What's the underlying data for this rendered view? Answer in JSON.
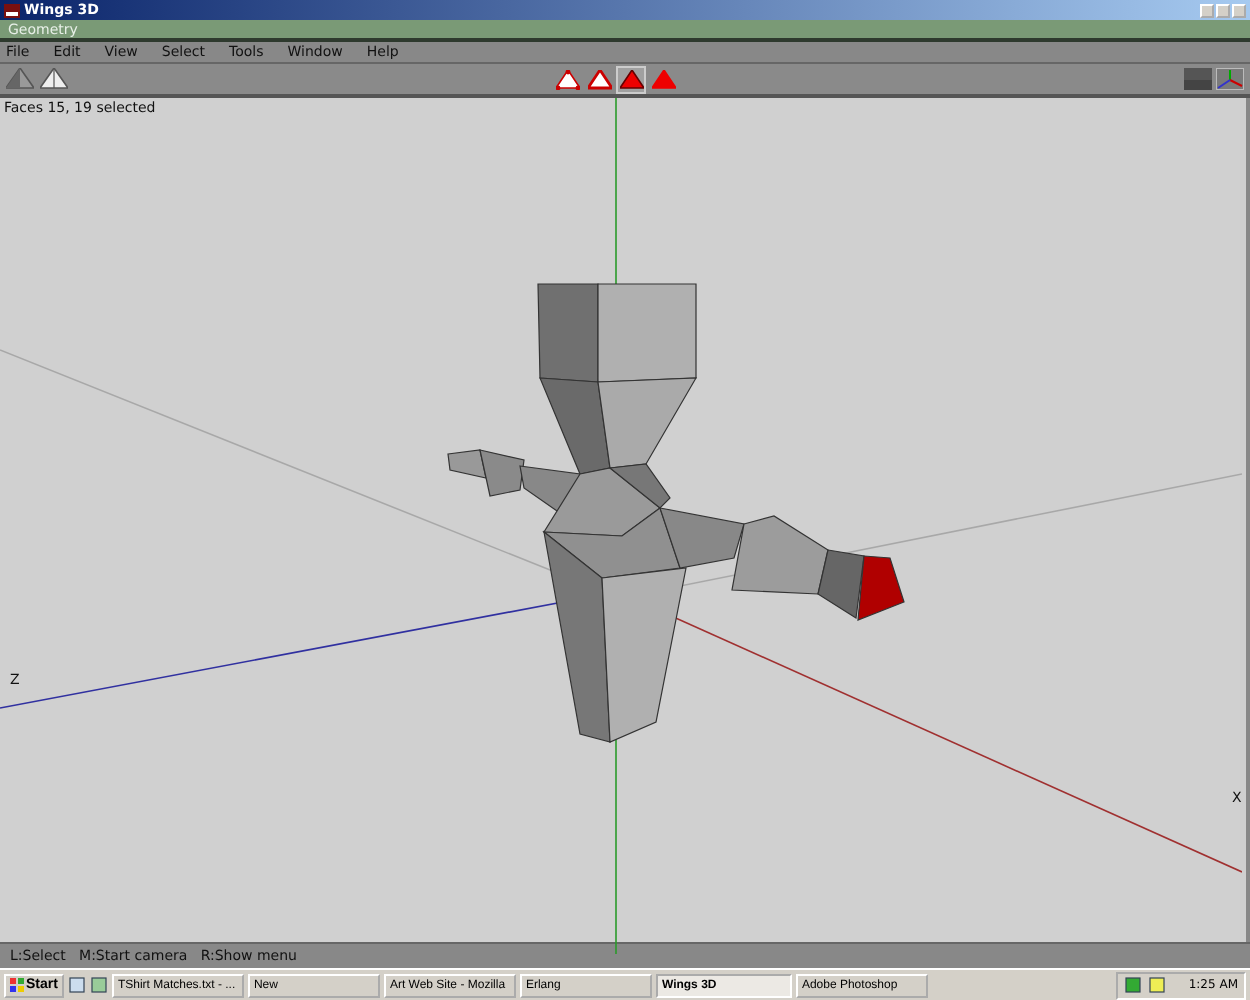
{
  "window": {
    "title": "Wings 3D"
  },
  "geometry_bar": {
    "title": "Geometry"
  },
  "menu": [
    "File",
    "Edit",
    "View",
    "Select",
    "Tools",
    "Window",
    "Help"
  ],
  "selection_modes": [
    {
      "kind": "vertex",
      "selected": false
    },
    {
      "kind": "edge",
      "selected": false
    },
    {
      "kind": "face",
      "selected": true
    },
    {
      "kind": "body",
      "selected": false
    }
  ],
  "viewport": {
    "info": "Faces 15, 19 selected",
    "axis_labels": [
      {
        "kind": "z",
        "text": "Z"
      },
      {
        "kind": "x",
        "text": "X"
      }
    ]
  },
  "status_bar": {
    "text": "L:Select   M:Start camera   R:Show menu"
  },
  "taskbar": {
    "start": "Start",
    "tasks": [
      {
        "label": "TShirt Matches.txt - ...",
        "selected": false
      },
      {
        "label": "New",
        "selected": false
      },
      {
        "label": "Art Web Site - Mozilla",
        "selected": false
      },
      {
        "label": "Erlang",
        "selected": false
      },
      {
        "label": "Wings 3D",
        "selected": true
      },
      {
        "label": "Adobe Photoshop",
        "selected": false
      }
    ],
    "clock": "1:25 AM"
  }
}
